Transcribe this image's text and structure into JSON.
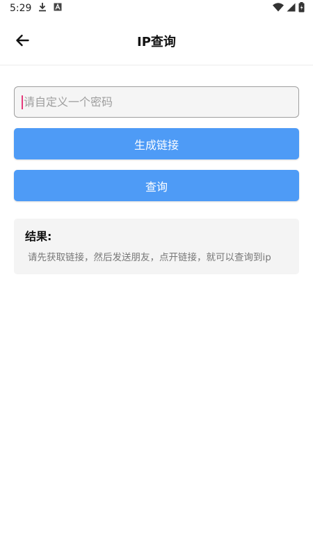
{
  "status_bar": {
    "time": "5:29",
    "icons": [
      "download-icon",
      "a-badge-icon",
      "wifi-icon",
      "signal-icon",
      "battery-icon"
    ]
  },
  "header": {
    "title": "IP查询",
    "back_icon": "arrow-left-icon"
  },
  "form": {
    "password_placeholder": "请自定义一个密码",
    "password_value": ""
  },
  "buttons": {
    "generate_label": "生成链接",
    "query_label": "查询"
  },
  "result": {
    "title": "结果:",
    "text": "请先获取链接，然后发送朋友，点开链接，就可以查询到ip"
  },
  "colors": {
    "primary": "#4e9bf6",
    "card_bg": "#f4f4f4",
    "caret": "#e53a7a"
  }
}
